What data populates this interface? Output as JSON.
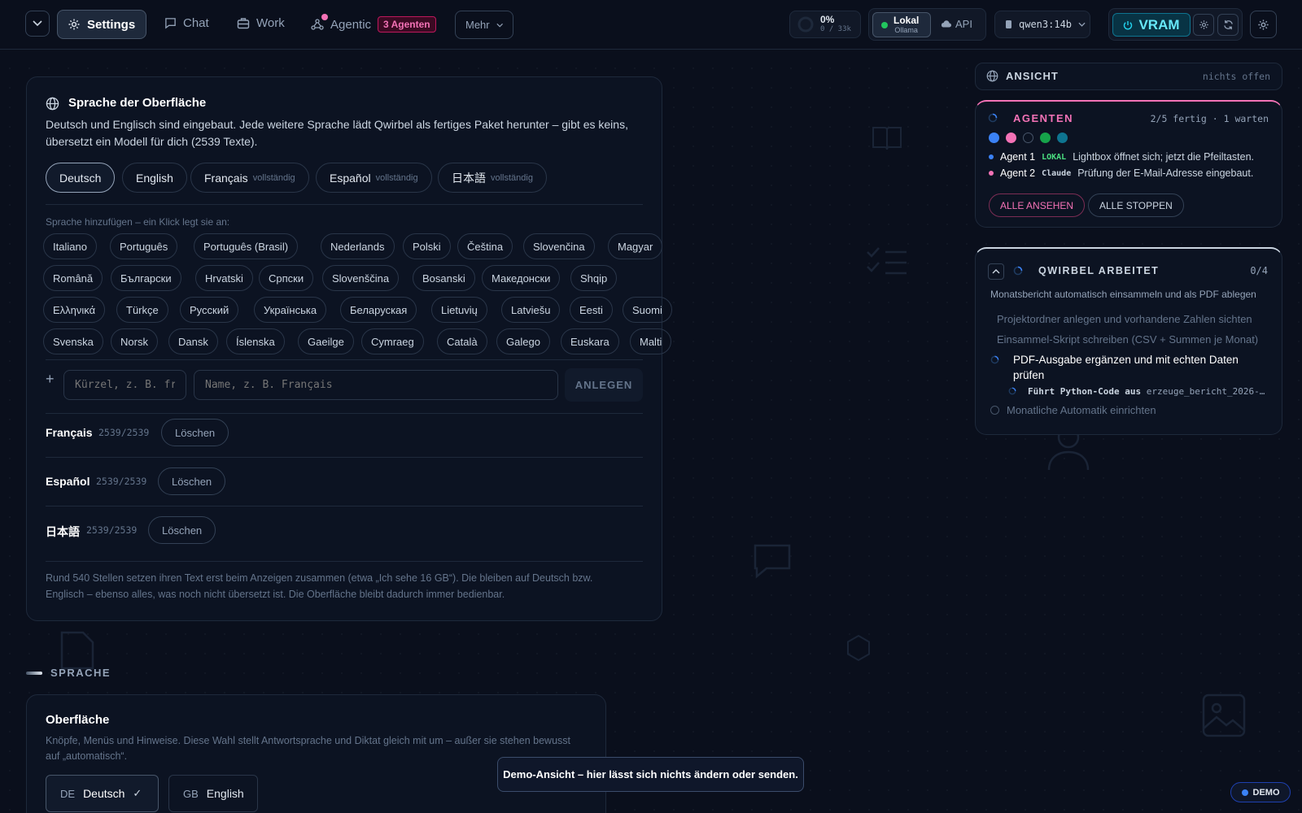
{
  "topbar": {
    "nav": {
      "settings": "Settings",
      "chat": "Chat",
      "work": "Work",
      "agentic": "Agentic",
      "agentic_badge": "3 Agenten",
      "more": "Mehr"
    },
    "context": {
      "percent": "0%",
      "tokens": "0 / 33k",
      "progress": 0
    },
    "mode": {
      "local": "Lokal",
      "local_sub": "Ollama",
      "api": "API"
    },
    "model": "qwen3:14b",
    "vram": "VRAM"
  },
  "language_panel": {
    "title": "Sprache der Oberfläche",
    "desc1": "Deutsch und Englisch sind eingebaut. Jede weitere Sprache lädt Qwirbel als fertiges Paket herunter – gibt es keins,",
    "desc2": "übersetzt ein Modell für dich (2539 Texte).",
    "installed": [
      {
        "label": "Deutsch",
        "tag": ""
      },
      {
        "label": "English",
        "tag": ""
      },
      {
        "label": "Français",
        "tag": "vollständig"
      },
      {
        "label": "Español",
        "tag": "vollständig"
      },
      {
        "label": "日本語",
        "tag": "vollständig"
      }
    ],
    "add_hint": "Sprache hinzufügen – ein Klick legt sie an:",
    "row1": [
      "Italiano",
      "Português",
      "Português (Brasil)",
      "Nederlands",
      "Polski",
      "Čeština",
      "Slovenčina",
      "Magyar"
    ],
    "row2": [
      "Română",
      "Български",
      "Hrvatski",
      "Српски",
      "Slovenščina",
      "Bosanski",
      "Македонски",
      "Shqip"
    ],
    "row3": [
      "Ελληνικά",
      "Türkçe",
      "Русский",
      "Українська",
      "Беларуская",
      "Lietuvių",
      "Latviešu",
      "Eesti",
      "Suomi"
    ],
    "row4": [
      "Svenska",
      "Norsk",
      "Dansk",
      "Íslenska",
      "Gaeilge",
      "Cymraeg",
      "Català",
      "Galego",
      "Euskara",
      "Malti"
    ],
    "code_placeholder": "Kürzel, z. B. fr",
    "name_placeholder": "Name, z. B. Français",
    "create": "ANLEGEN",
    "packs": [
      {
        "name": "Français",
        "count": "2539/2539",
        "delete": "Löschen"
      },
      {
        "name": "Español",
        "count": "2539/2539",
        "delete": "Löschen"
      },
      {
        "name": "日本語",
        "count": "2539/2539",
        "delete": "Löschen"
      }
    ],
    "note1": "Rund 540 Stellen setzen ihren Text erst beim Anzeigen zusammen (etwa „Ich sehe 16 GB“). Die bleiben auf Deutsch bzw.",
    "note2": "Englisch – ebenso alles, was noch nicht übersetzt ist. Die Oberfläche bleibt dadurch immer bedienbar."
  },
  "section_label": "SPRACHE",
  "surface_panel": {
    "title": "Oberfläche",
    "desc1": "Knöpfe, Menüs und Hinweise. Diese Wahl stellt Antwortsprache und Diktat gleich mit um – außer sie stehen bewusst",
    "desc2": "auf „automatisch“.",
    "options": [
      {
        "code": "DE",
        "label": "Deutsch",
        "check": "✓"
      },
      {
        "code": "GB",
        "label": "English"
      }
    ]
  },
  "view_panel": {
    "title": "ANSICHT",
    "status": "nichts offen"
  },
  "agents_panel": {
    "title": "AGENTEN",
    "status": "2/5 fertig · 1 warten",
    "dot_colors": [
      "#3b82f6",
      "#f472b6",
      "#334155",
      "#16a34a",
      "#0e7490"
    ],
    "rows": [
      {
        "name": "Agent 1",
        "tag": "LOKAL",
        "text": "Lightbox öffnet sich; jetzt die Pfeiltasten.",
        "color": "#3b82f6",
        "tagColor": "#4ade80"
      },
      {
        "name": "Agent 2",
        "tag": "Claude",
        "text": "Prüfung der E-Mail-Adresse eingebaut.",
        "color": "#f472b6",
        "tagColor": "#cbd5e1"
      }
    ],
    "view_all": "ALLE ANSEHEN",
    "stop_all": "ALLE STOPPEN"
  },
  "work_panel": {
    "title": "QWIRBEL ARBEITET",
    "count": "0/4",
    "goal": "Monatsbericht automatisch einsammeln und als PDF ablegen",
    "steps": [
      "Projektordner anlegen und vorhandene Zahlen sichten",
      "Einsammel-Skript schreiben (CSV + Summen je Monat)"
    ],
    "active_step1": "PDF-Ausgabe ergänzen und mit echten Daten",
    "active_step2": "prüfen",
    "sub_label": "Führt Python-Code aus",
    "sub_file": "erzeuge_bericht_2026-…",
    "next_step": "Monatliche Automatik einrichten"
  },
  "toast": "Demo-Ansicht – hier lässt sich nichts ändern oder senden.",
  "demo_badge": "DEMO"
}
